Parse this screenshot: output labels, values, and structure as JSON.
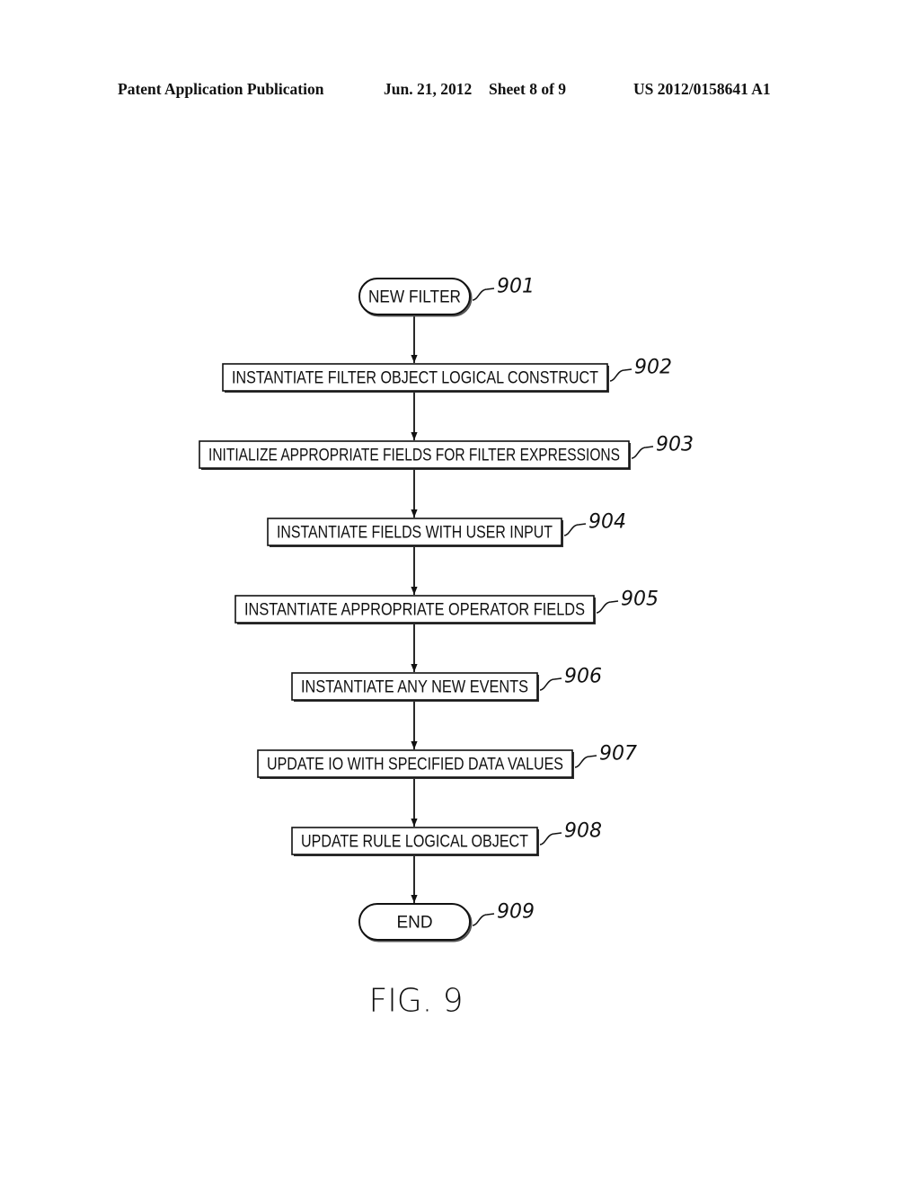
{
  "header": {
    "publication": "Patent Application Publication",
    "date": "Jun. 21, 2012",
    "sheet": "Sheet 8 of 9",
    "number": "US 2012/0158641 A1"
  },
  "flowchart": {
    "nodes": [
      {
        "id": "901",
        "type": "terminator",
        "label": "NEW FILTER",
        "ref": "901"
      },
      {
        "id": "902",
        "type": "process",
        "label": "INSTANTIATE FILTER OBJECT LOGICAL CONSTRUCT",
        "ref": "902"
      },
      {
        "id": "903",
        "type": "process",
        "label": "INITIALIZE APPROPRIATE FIELDS FOR FILTER EXPRESSIONS",
        "ref": "903"
      },
      {
        "id": "904",
        "type": "process",
        "label": "INSTANTIATE FIELDS WITH USER INPUT",
        "ref": "904"
      },
      {
        "id": "905",
        "type": "process",
        "label": "INSTANTIATE APPROPRIATE OPERATOR FIELDS",
        "ref": "905"
      },
      {
        "id": "906",
        "type": "process",
        "label": "INSTANTIATE ANY NEW EVENTS",
        "ref": "906"
      },
      {
        "id": "907",
        "type": "process",
        "label": "UPDATE IO WITH SPECIFIED DATA VALUES",
        "ref": "907"
      },
      {
        "id": "908",
        "type": "process",
        "label": "UPDATE RULE LOGICAL OBJECT",
        "ref": "908"
      },
      {
        "id": "909",
        "type": "terminator",
        "label": "END",
        "ref": "909"
      }
    ],
    "edges": [
      [
        "901",
        "902"
      ],
      [
        "902",
        "903"
      ],
      [
        "903",
        "904"
      ],
      [
        "904",
        "905"
      ],
      [
        "905",
        "906"
      ],
      [
        "906",
        "907"
      ],
      [
        "907",
        "908"
      ],
      [
        "908",
        "909"
      ]
    ]
  },
  "figure_label": "FIG. 9"
}
